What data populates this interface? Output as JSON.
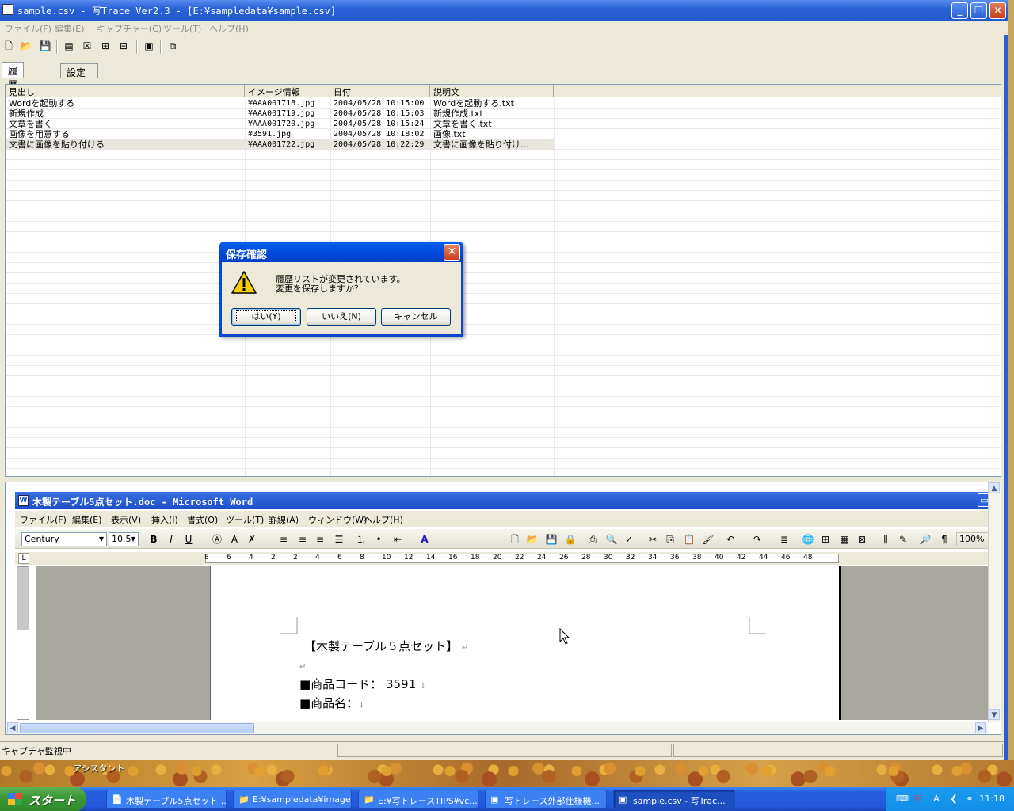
{
  "main_window": {
    "title": "sample.csv - 写Trace Ver2.3 - [E:¥sampledata¥sample.csv]",
    "menu": [
      "ファイル(F)",
      "編集(E)",
      "キャプチャー(C)",
      "ツール(T)",
      "ヘルプ(H)"
    ],
    "toolbar_icons": [
      "new-icon",
      "open-icon",
      "save-icon",
      "capture-window-icon",
      "delete-icon",
      "import-icon",
      "export-icon",
      "record-icon",
      "window-icon"
    ],
    "tabs": [
      "履歴データ",
      "設定"
    ],
    "columns": [
      "見出し",
      "イメージ情報",
      "日付",
      "説明文"
    ],
    "rows": [
      {
        "heading": "Wordを起動する",
        "image": "¥AAA001718.jpg",
        "date": "2004/05/28 10:15:00",
        "desc": "Wordを起動する.txt"
      },
      {
        "heading": "新規作成",
        "image": "¥AAA001719.jpg",
        "date": "2004/05/28 10:15:03",
        "desc": "新規作成.txt"
      },
      {
        "heading": "文章を書く",
        "image": "¥AAA001720.jpg",
        "date": "2004/05/28 10:15:24",
        "desc": "文章を書く.txt"
      },
      {
        "heading": "画像を用意する",
        "image": "¥3591.jpg",
        "date": "2004/05/28 10:18:02",
        "desc": "画像.txt"
      },
      {
        "heading": "文書に画像を貼り付ける",
        "image": "¥AAA001722.jpg",
        "date": "2004/05/28 10:22:29",
        "desc": "文書に画像を貼り付け..."
      }
    ],
    "status": "キャプチャ監視中"
  },
  "dialog": {
    "title": "保存確認",
    "message": "履歴リストが変更されています。\n変更を保存しますか？",
    "buttons": {
      "yes": "はい(Y)",
      "no": "いいえ(N)",
      "cancel": "キャンセル"
    }
  },
  "word": {
    "title": "木製テーブル5点セット.doc - Microsoft Word",
    "menu": [
      "ファイル(F)",
      "編集(E)",
      "表示(V)",
      "挿入(I)",
      "書式(O)",
      "ツール(T)",
      "罫線(A)",
      "ウィンドウ(W)",
      "ヘルプ(H)"
    ],
    "font": "Century",
    "font_size": "10.5",
    "zoom": "100%",
    "ruler_ticks": [
      "8",
      "6",
      "4",
      "2",
      "2",
      "4",
      "6",
      "8",
      "10",
      "12",
      "14",
      "16",
      "18",
      "20",
      "22",
      "24",
      "26",
      "28",
      "30",
      "32",
      "34",
      "36",
      "38",
      "40",
      "42",
      "44",
      "46",
      "48"
    ],
    "doc_lines": [
      "【木製テーブル５点セット】",
      "",
      "■商品コード： 3591",
      "■商品名："
    ]
  },
  "desktop": {
    "label": "アシスタント"
  },
  "taskbar": {
    "start": "スタート",
    "tasks": [
      {
        "label": "木製テーブル5点セット ..."
      },
      {
        "label": "E:¥sampledata¥images"
      },
      {
        "label": "E:¥写トレースTIPS¥vc..."
      },
      {
        "label": "写トレース外部仕様機..."
      },
      {
        "label": "sample.csv - 写Trac..."
      }
    ],
    "clock": "11:18"
  }
}
